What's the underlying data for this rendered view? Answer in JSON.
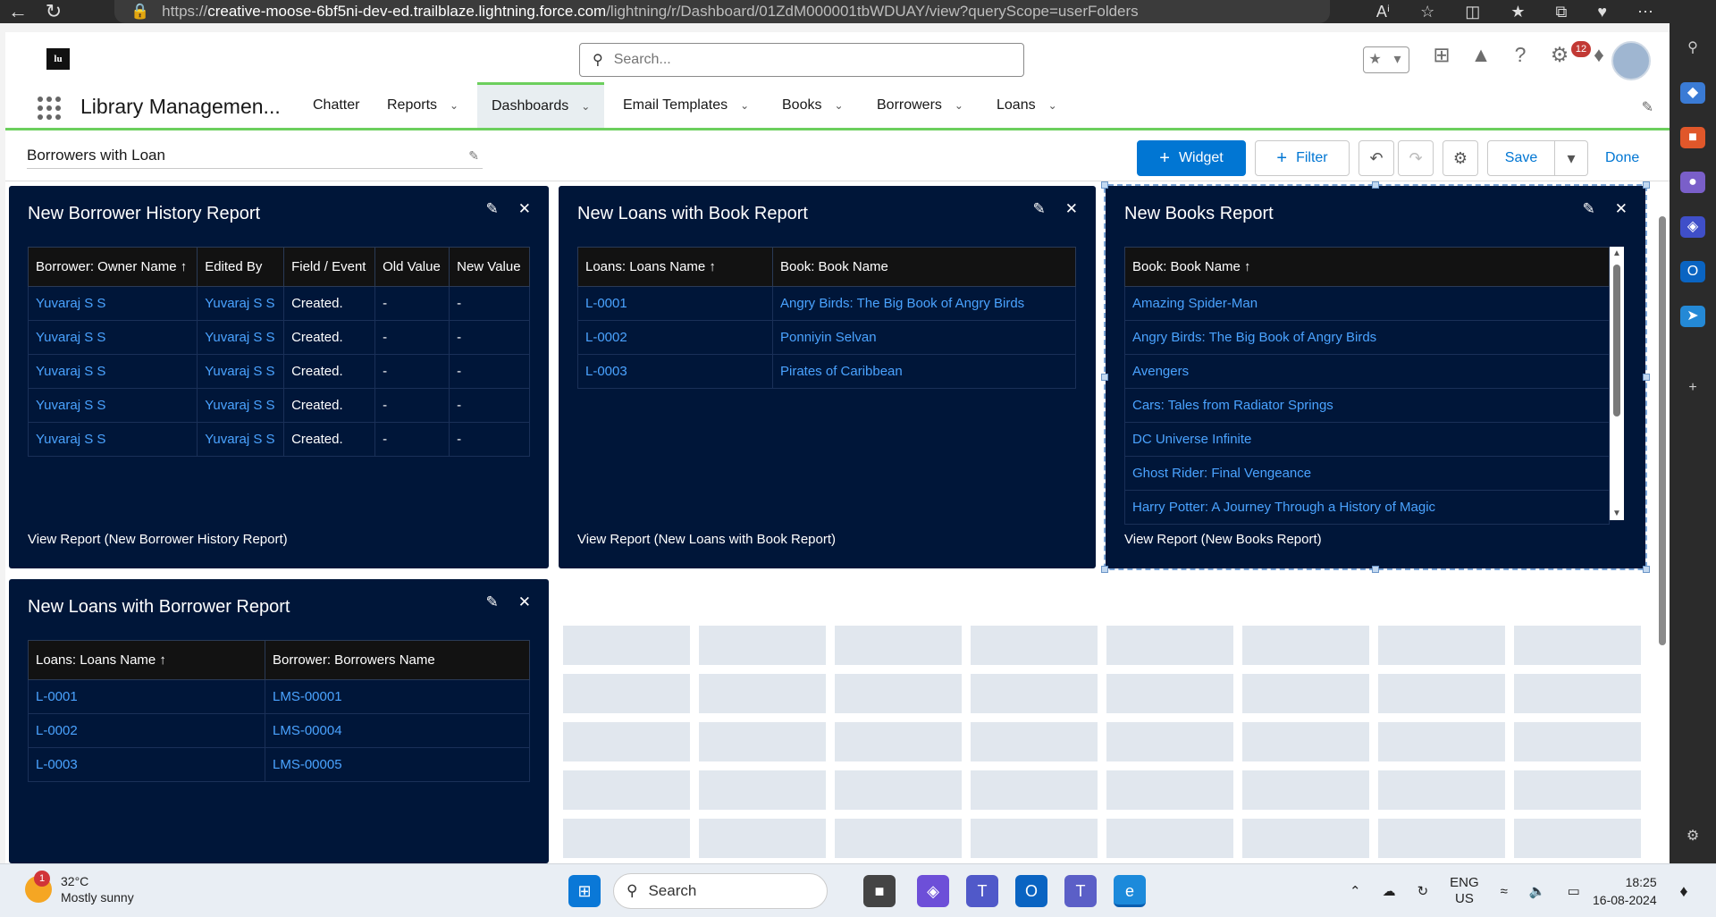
{
  "browser": {
    "url_prefix": "https://",
    "url_host": "creative-moose-6bf5ni-dev-ed.trailblaze.lightning.force.com",
    "url_path": "/lightning/r/Dashboard/01ZdM000001tbWDUAY/view?queryScope=userFolders"
  },
  "header": {
    "search_placeholder": "Search...",
    "notification_count": "12"
  },
  "nav": {
    "app_name": "Library Managemen...",
    "items": [
      {
        "label": "Chatter"
      },
      {
        "label": "Reports"
      },
      {
        "label": "Dashboards"
      },
      {
        "label": "Email Templates"
      },
      {
        "label": "Books"
      },
      {
        "label": "Borrowers"
      },
      {
        "label": "Loans"
      }
    ]
  },
  "toolbar": {
    "dashboard_name": "Borrowers with Loan",
    "widget_label": "Widget",
    "filter_label": "Filter",
    "save_label": "Save",
    "done_label": "Done"
  },
  "widgets": {
    "borrower_history": {
      "title": "New Borrower History Report",
      "columns": [
        "Borrower: Owner Name ↑",
        "Edited By",
        "Field / Event",
        "Old Value",
        "New Value"
      ],
      "rows": [
        [
          "Yuvaraj S S",
          "Yuvaraj S S",
          "Created.",
          "-",
          "-"
        ],
        [
          "Yuvaraj S S",
          "Yuvaraj S S",
          "Created.",
          "-",
          "-"
        ],
        [
          "Yuvaraj S S",
          "Yuvaraj S S",
          "Created.",
          "-",
          "-"
        ],
        [
          "Yuvaraj S S",
          "Yuvaraj S S",
          "Created.",
          "-",
          "-"
        ],
        [
          "Yuvaraj S S",
          "Yuvaraj S S",
          "Created.",
          "-",
          "-"
        ]
      ],
      "footer": "View Report (New Borrower History Report)"
    },
    "loans_book": {
      "title": "New Loans with Book Report",
      "columns": [
        "Loans: Loans Name ↑",
        "Book: Book Name"
      ],
      "rows": [
        [
          "L-0001",
          "Angry Birds: The Big Book of Angry Birds"
        ],
        [
          "L-0002",
          "Ponniyin Selvan"
        ],
        [
          "L-0003",
          "Pirates of Caribbean"
        ]
      ],
      "footer": "View Report (New Loans with Book Report)"
    },
    "books": {
      "title": "New Books Report",
      "columns": [
        "Book: Book Name ↑"
      ],
      "rows": [
        [
          "Amazing Spider-Man"
        ],
        [
          "Angry Birds: The Big Book of Angry Birds"
        ],
        [
          "Avengers"
        ],
        [
          "Cars: Tales from Radiator Springs"
        ],
        [
          "DC Universe Infinite"
        ],
        [
          "Ghost Rider: Final Vengeance"
        ],
        [
          "Harry Potter: A Journey Through a History of Magic"
        ]
      ],
      "footer": "View Report (New Books Report)"
    },
    "loans_borrower": {
      "title": "New Loans with Borrower Report",
      "columns": [
        "Loans: Loans Name ↑",
        "Borrower: Borrowers Name"
      ],
      "rows": [
        [
          "L-0001",
          "LMS-00001"
        ],
        [
          "L-0002",
          "LMS-00004"
        ],
        [
          "L-0003",
          "LMS-00005"
        ]
      ]
    }
  },
  "taskbar": {
    "temperature": "32°C",
    "weather": "Mostly sunny",
    "weather_badge": "1",
    "search_label": "Search",
    "lang_1": "ENG",
    "lang_2": "US",
    "time": "18:25",
    "date": "16-08-2024"
  }
}
